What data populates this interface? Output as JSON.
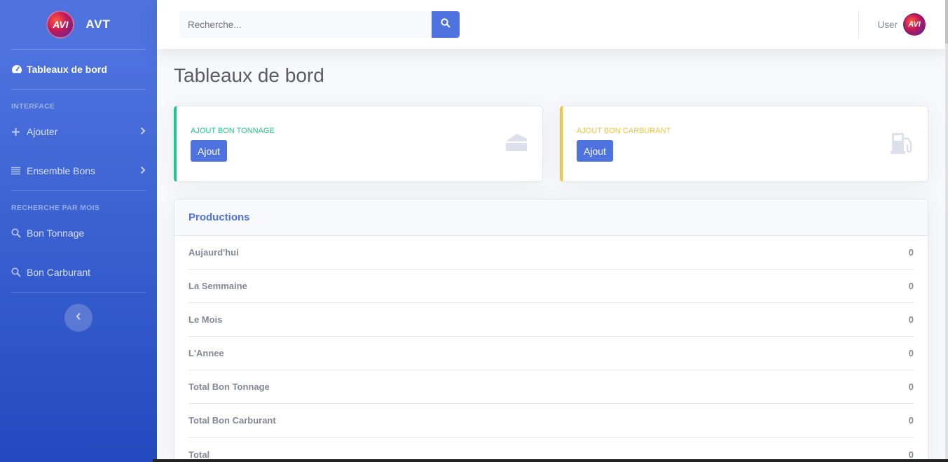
{
  "brand": {
    "name": "AVT",
    "logo_text": "AVI"
  },
  "sidebar": {
    "dashboard": {
      "label": "Tableaux de bord",
      "icon": "tachometer-icon"
    },
    "heading_interface": "INTERFACE",
    "items_interface": [
      {
        "label": "Ajouter",
        "icon": "plus-icon"
      },
      {
        "label": "Ensemble Bons",
        "icon": "list-icon"
      }
    ],
    "heading_search": "RECHERCHE PAR MOIS",
    "items_search": [
      {
        "label": "Bon Tonnage",
        "icon": "search-icon"
      },
      {
        "label": "Bon Carburant",
        "icon": "search-icon"
      }
    ],
    "toggle_icon": "chevron-left-icon"
  },
  "topbar": {
    "search_placeholder": "Recherche...",
    "user_name": "User"
  },
  "page_title": "Tableaux de bord",
  "cards": [
    {
      "label": "AJOUT BON TONNAGE",
      "button": "Ajout",
      "color": "#1cc88a",
      "icon": "weight-icon"
    },
    {
      "label": "AJOUT BON CARBURANT",
      "button": "Ajout",
      "color": "#f6c23e",
      "icon": "gas-pump-icon"
    }
  ],
  "productions": {
    "title": "Productions",
    "rows": [
      {
        "label": "Aujaurd'hui",
        "value": "0"
      },
      {
        "label": "La Semmaine",
        "value": "0"
      },
      {
        "label": "Le Mois",
        "value": "0"
      },
      {
        "label": "L'Annee",
        "value": "0"
      },
      {
        "label": "Total Bon Tonnage",
        "value": "0"
      },
      {
        "label": "Total Bon Carburant",
        "value": "0"
      },
      {
        "label": "Total",
        "value": "0"
      }
    ]
  },
  "colors": {
    "primary": "#4e73df",
    "success": "#1cc88a",
    "warning": "#f6c23e"
  }
}
